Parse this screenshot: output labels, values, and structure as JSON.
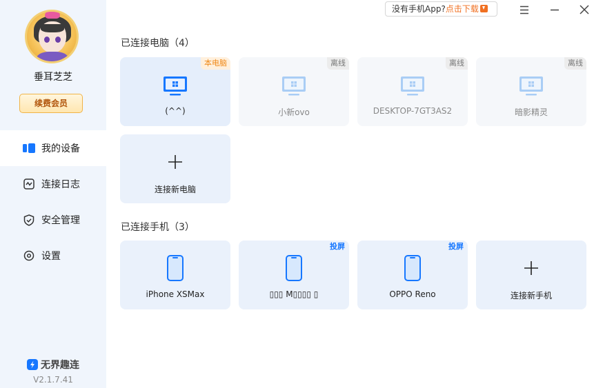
{
  "user": {
    "name": "垂耳芝芝",
    "vip_button": "续费会员"
  },
  "nav": [
    {
      "label": "我的设备",
      "icon": "devices-icon",
      "active": true
    },
    {
      "label": "连接日志",
      "icon": "log-icon",
      "active": false
    },
    {
      "label": "安全管理",
      "icon": "shield-icon",
      "active": false
    },
    {
      "label": "设置",
      "icon": "settings-icon",
      "active": false
    }
  ],
  "brand": {
    "name": "无界趣连",
    "version": "V2.1.7.41"
  },
  "topbar": {
    "app_prompt": "没有手机App?",
    "app_link": "点击下载"
  },
  "computers": {
    "title": "已连接电脑（4）",
    "items": [
      {
        "name": "(^^)",
        "tag": "本电脑",
        "status": "this"
      },
      {
        "name": "小新ovo",
        "tag": "离线",
        "status": "offline"
      },
      {
        "name": "DESKTOP-7GT3AS2",
        "tag": "离线",
        "status": "offline"
      },
      {
        "name": "暗影精灵",
        "tag": "离线",
        "status": "offline"
      }
    ],
    "add_label": "连接新电脑"
  },
  "phones": {
    "title": "已连接手机（3）",
    "items": [
      {
        "name": "iPhone XSMax",
        "tag": ""
      },
      {
        "name": "▯▯▯ M▯▯▯▯ ▯",
        "tag": "投屏"
      },
      {
        "name": "OPPO Reno",
        "tag": "投屏"
      }
    ],
    "add_label": "连接新手机"
  },
  "colors": {
    "accent": "#1677ff",
    "vip_text": "#b2560c",
    "download_link": "#f07022",
    "sidebar_bg": "#f0f5fc",
    "card_bg": "#eaf1fb"
  }
}
